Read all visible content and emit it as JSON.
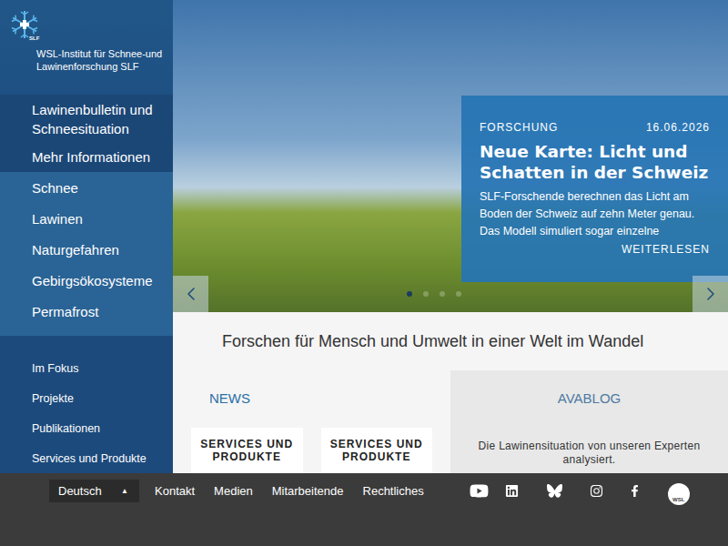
{
  "logo": {
    "name": "WSL-Institut für Schnee-und Lawinenforschung SLF",
    "badge": "SLF"
  },
  "sidebar": {
    "primary": [
      {
        "label": "Lawinenbulletin und Schneesituation"
      },
      {
        "label": "Mehr Informationen"
      }
    ],
    "topics": [
      {
        "label": "Schnee"
      },
      {
        "label": "Lawinen"
      },
      {
        "label": "Naturgefahren"
      },
      {
        "label": "Gebirgsökosysteme"
      },
      {
        "label": "Permafrost"
      }
    ],
    "links": [
      {
        "label": "Im Fokus"
      },
      {
        "label": "Projekte"
      },
      {
        "label": "Publikationen"
      },
      {
        "label": "Services und Produkte"
      }
    ]
  },
  "hero": {
    "category": "FORSCHUNG",
    "date": "16.06.2026",
    "title": "Neue Karte: Licht und Schatten in der Schweiz",
    "body": "SLF-Forschende berechnen das Licht am Boden der Schweiz auf zehn Meter genau. Das Modell simuliert sogar einzelne",
    "more": "WEITERLESEN",
    "slides": [
      {
        "selected": true
      },
      {
        "selected": false
      },
      {
        "selected": false
      },
      {
        "selected": false
      }
    ]
  },
  "tagline": "Forschen für Mensch und Umwelt in einer Welt im Wandel",
  "news": {
    "title": "NEWS",
    "cards": [
      {
        "label": "SERVICES UND PRODUKTE"
      },
      {
        "label": "SERVICES UND PRODUKTE"
      }
    ]
  },
  "avablog": {
    "title": "AVABLOG",
    "text": "Die Lawinensituation von unseren Experten analysiert."
  },
  "footer": {
    "language": "Deutsch",
    "language_arrow": "▲",
    "links": [
      "Kontakt",
      "Medien",
      "Mitarbeitende",
      "Rechtliches"
    ],
    "wsl_logo": "WSL"
  }
}
